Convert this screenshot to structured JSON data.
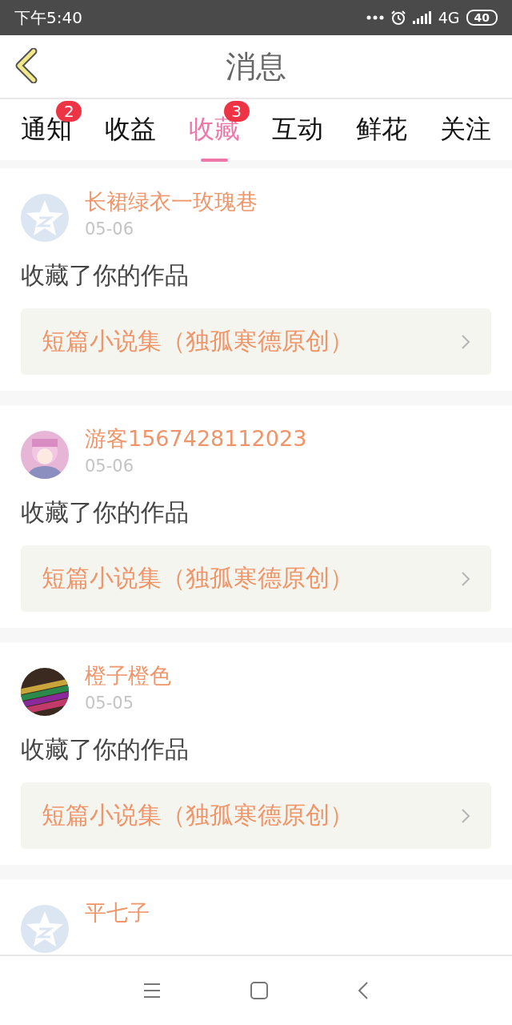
{
  "status_bar": {
    "time": "下午5:40",
    "network": "4G",
    "battery": "40"
  },
  "header": {
    "title": "消息"
  },
  "tabs": [
    {
      "label": "通知",
      "selected": false,
      "badge": "2"
    },
    {
      "label": "收益",
      "selected": false
    },
    {
      "label": "收藏",
      "selected": true,
      "badge": "3"
    },
    {
      "label": "互动",
      "selected": false
    },
    {
      "label": "鲜花",
      "selected": false
    },
    {
      "label": "关注",
      "selected": false
    }
  ],
  "messages": [
    {
      "user": "长裙绿衣一玫瑰巷",
      "avatar": {
        "kind": "default"
      },
      "date": "05-06",
      "text": "收藏了你的作品",
      "work": "短篇小说集（独孤寒德原创）"
    },
    {
      "user": "游客1567428112023",
      "date": "05-06",
      "text": "收藏了你的作品",
      "work": "短篇小说集（独孤寒德原创）"
    },
    {
      "user": "橙子橙色",
      "date": "05-05",
      "text": "收藏了你的作品",
      "work": "短篇小说集（独孤寒德原创）"
    },
    {
      "user": "平七子",
      "avatar": {
        "kind": "default"
      }
    }
  ]
}
